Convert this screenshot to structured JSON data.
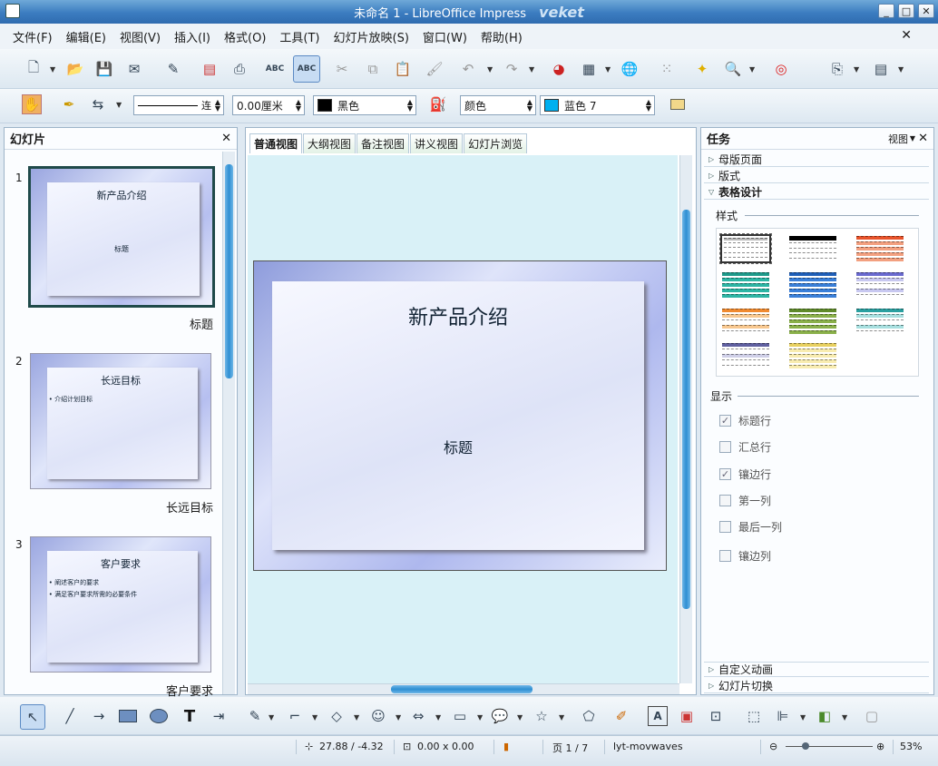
{
  "window": {
    "title": "未命名 1 - LibreOffice Impress",
    "watermark": "veket"
  },
  "menu": [
    "文件(F)",
    "编辑(E)",
    "视图(V)",
    "插入(I)",
    "格式(O)",
    "工具(T)",
    "幻灯片放映(S)",
    "窗口(W)",
    "帮助(H)"
  ],
  "toolbar2": {
    "line_style": "连",
    "line_width": "0.00厘米",
    "line_color": "黑色",
    "area_mode": "颜色",
    "area_color": "蓝色 7"
  },
  "colors": {
    "line_color": "#000000",
    "area_color": "#00b0f0"
  },
  "slides_panel": {
    "title": "幻灯片",
    "slides": [
      {
        "num": "1",
        "title": "新产品介绍",
        "subtitle": "标题",
        "bullets": [],
        "name": "标题"
      },
      {
        "num": "2",
        "title": "长远目标",
        "subtitle": "",
        "bullets": [
          "• 介绍计划目标"
        ],
        "name": "长远目标"
      },
      {
        "num": "3",
        "title": "客户要求",
        "subtitle": "",
        "bullets": [
          "• 阐述客户的要求",
          "• 满足客户要求所需的必要条件"
        ],
        "name": "客户要求"
      }
    ]
  },
  "main": {
    "tabs": [
      "普通视图",
      "大纲视图",
      "备注视图",
      "讲义视图",
      "幻灯片浏览"
    ],
    "slide_title": "新产品介绍",
    "slide_subtitle": "标题"
  },
  "task_panel": {
    "title": "任务",
    "view_label": "视图",
    "sections_top": [
      "母版页面",
      "版式"
    ],
    "active_section": "表格设计",
    "style_label": "样式",
    "display_label": "显示",
    "checks": [
      {
        "label": "标题行",
        "checked": true
      },
      {
        "label": "汇总行",
        "checked": false
      },
      {
        "label": "镶边行",
        "checked": true
      },
      {
        "label": "第一列",
        "checked": false
      },
      {
        "label": "最后一列",
        "checked": false
      },
      {
        "label": "镶边列",
        "checked": false
      }
    ],
    "sections_bottom": [
      "自定义动画",
      "幻灯片切换"
    ],
    "table_styles": [
      "#333333",
      "#000000",
      "#e8532a",
      "#1e9a8a",
      "#1f5fb8",
      "#6a6ad0",
      "#f08a30",
      "#5f8a2a",
      "#2aa0a0",
      "#6060a0",
      "#e8d060"
    ]
  },
  "status": {
    "position": "27.88 / -4.32",
    "size": "0.00 x 0.00",
    "page": "页 1 / 7",
    "master": "lyt-movwaves",
    "zoom": "53%"
  }
}
